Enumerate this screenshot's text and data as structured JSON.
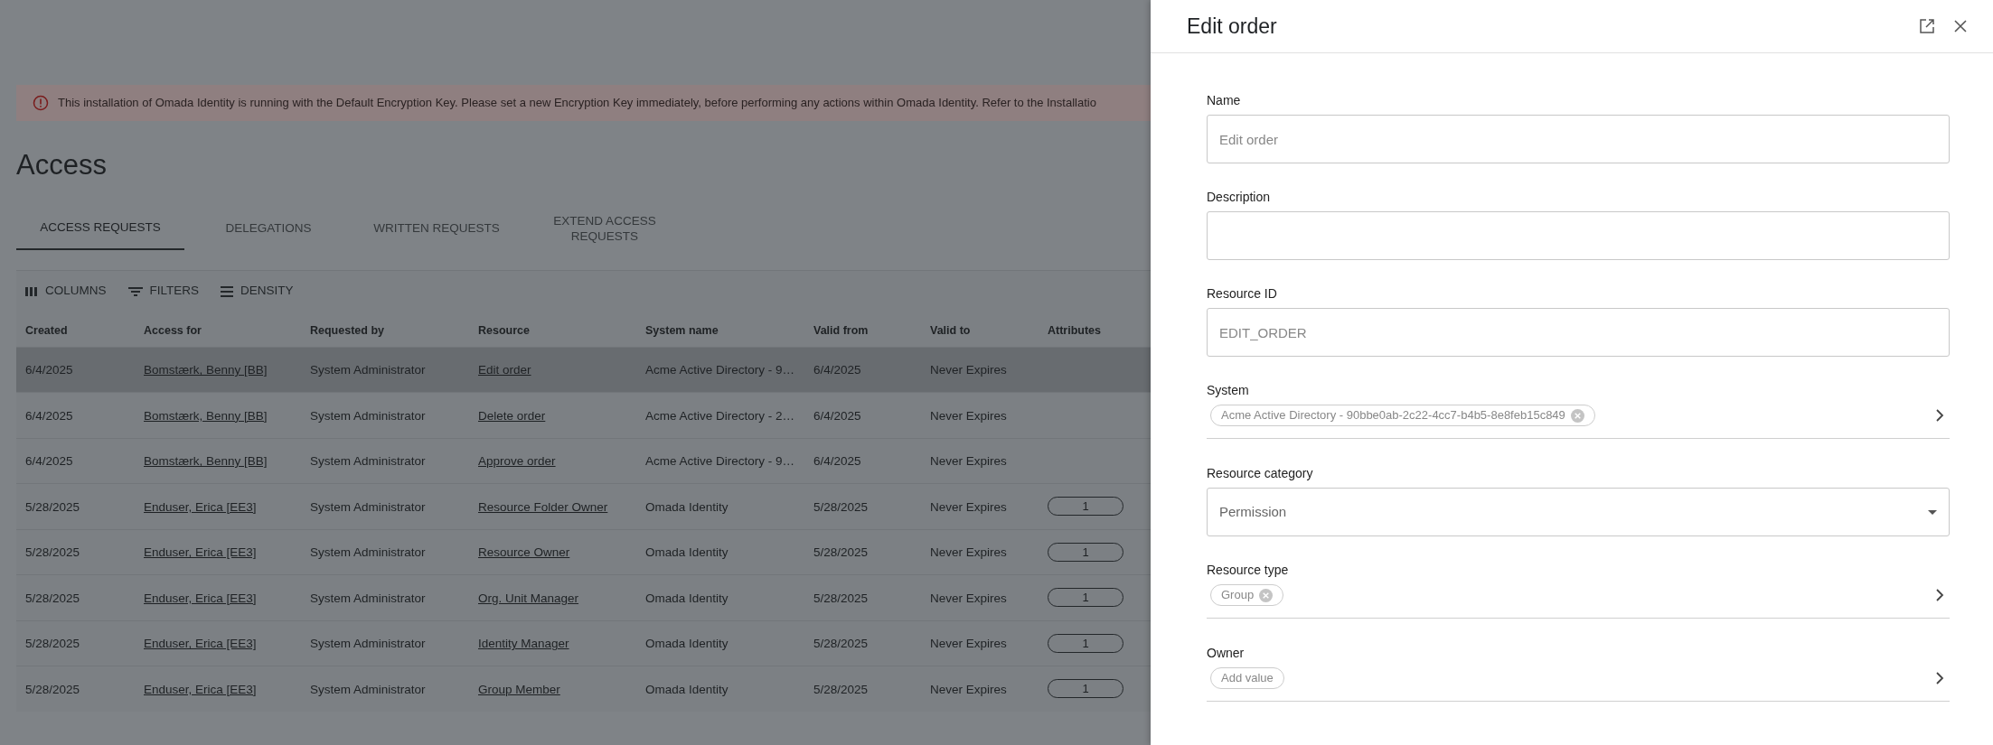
{
  "banner": {
    "text": "This installation of Omada Identity is running with the Default Encryption Key. Please set a new Encryption Key immediately, before performing any actions within Omada Identity. Refer to the Installatio"
  },
  "page_title": "Access",
  "tabs": [
    {
      "label": "ACCESS REQUESTS",
      "selected": true
    },
    {
      "label": "DELEGATIONS",
      "selected": false
    },
    {
      "label": "WRITTEN REQUESTS",
      "selected": false
    },
    {
      "label": "EXTEND ACCESS REQUESTS",
      "selected": false
    }
  ],
  "toolbar": [
    {
      "kind": "columns",
      "label": "COLUMNS"
    },
    {
      "kind": "filters",
      "label": "FILTERS"
    },
    {
      "kind": "density",
      "label": "DENSITY"
    }
  ],
  "table": {
    "columns": [
      "Created",
      "Access for",
      "Requested by",
      "Resource",
      "System name",
      "Valid from",
      "Valid to",
      "Attributes"
    ],
    "rows": [
      {
        "selected": true,
        "cells": [
          "6/4/2025",
          "Bomstærk, Benny [BB]",
          "System Administrator",
          "Edit order",
          "Acme Active Directory - 9…",
          "6/4/2025",
          "Never Expires"
        ]
      },
      {
        "selected": false,
        "cells": [
          "6/4/2025",
          "Bomstærk, Benny [BB]",
          "System Administrator",
          "Delete order",
          "Acme Active Directory - 2…",
          "6/4/2025",
          "Never Expires"
        ]
      },
      {
        "selected": false,
        "cells": [
          "6/4/2025",
          "Bomstærk, Benny [BB]",
          "System Administrator",
          "Approve order",
          "Acme Active Directory - 9…",
          "6/4/2025",
          "Never Expires"
        ]
      },
      {
        "selected": false,
        "cells": [
          "5/28/2025",
          "Enduser, Erica [EE3]",
          "System Administrator",
          "Resource Folder Owner",
          "Omada Identity",
          "5/28/2025",
          "Never Expires"
        ],
        "attributes": "1"
      },
      {
        "selected": false,
        "cells": [
          "5/28/2025",
          "Enduser, Erica [EE3]",
          "System Administrator",
          "Resource Owner",
          "Omada Identity",
          "5/28/2025",
          "Never Expires"
        ],
        "attributes": "1"
      },
      {
        "selected": false,
        "cells": [
          "5/28/2025",
          "Enduser, Erica [EE3]",
          "System Administrator",
          "Org. Unit Manager",
          "Omada Identity",
          "5/28/2025",
          "Never Expires"
        ],
        "attributes": "1"
      },
      {
        "selected": false,
        "cells": [
          "5/28/2025",
          "Enduser, Erica [EE3]",
          "System Administrator",
          "Identity Manager",
          "Omada Identity",
          "5/28/2025",
          "Never Expires"
        ],
        "attributes": "1"
      },
      {
        "selected": false,
        "cells": [
          "5/28/2025",
          "Enduser, Erica [EE3]",
          "System Administrator",
          "Group Member",
          "Omada Identity",
          "5/28/2025",
          "Never Expires"
        ],
        "attributes": "1"
      }
    ]
  },
  "panel": {
    "title": "Edit order",
    "fields": [
      {
        "kind": "text",
        "label": "Name",
        "placeholder": "Edit order"
      },
      {
        "kind": "text",
        "label": "Description"
      },
      {
        "kind": "text",
        "label": "Resource ID",
        "placeholder": "EDIT_ORDER"
      },
      {
        "kind": "chips",
        "label": "System",
        "chip": "Acme Active Directory - 90bbe0ab-2c22-4cc7-b4b5-8e8feb15c849",
        "removable": true
      },
      {
        "kind": "select",
        "label": "Resource category",
        "value": "Permission"
      },
      {
        "kind": "chips",
        "label": "Resource type",
        "chip": "Group",
        "removable": true
      },
      {
        "kind": "chips",
        "label": "Owner",
        "chip": "Add value",
        "removable": false
      }
    ]
  }
}
